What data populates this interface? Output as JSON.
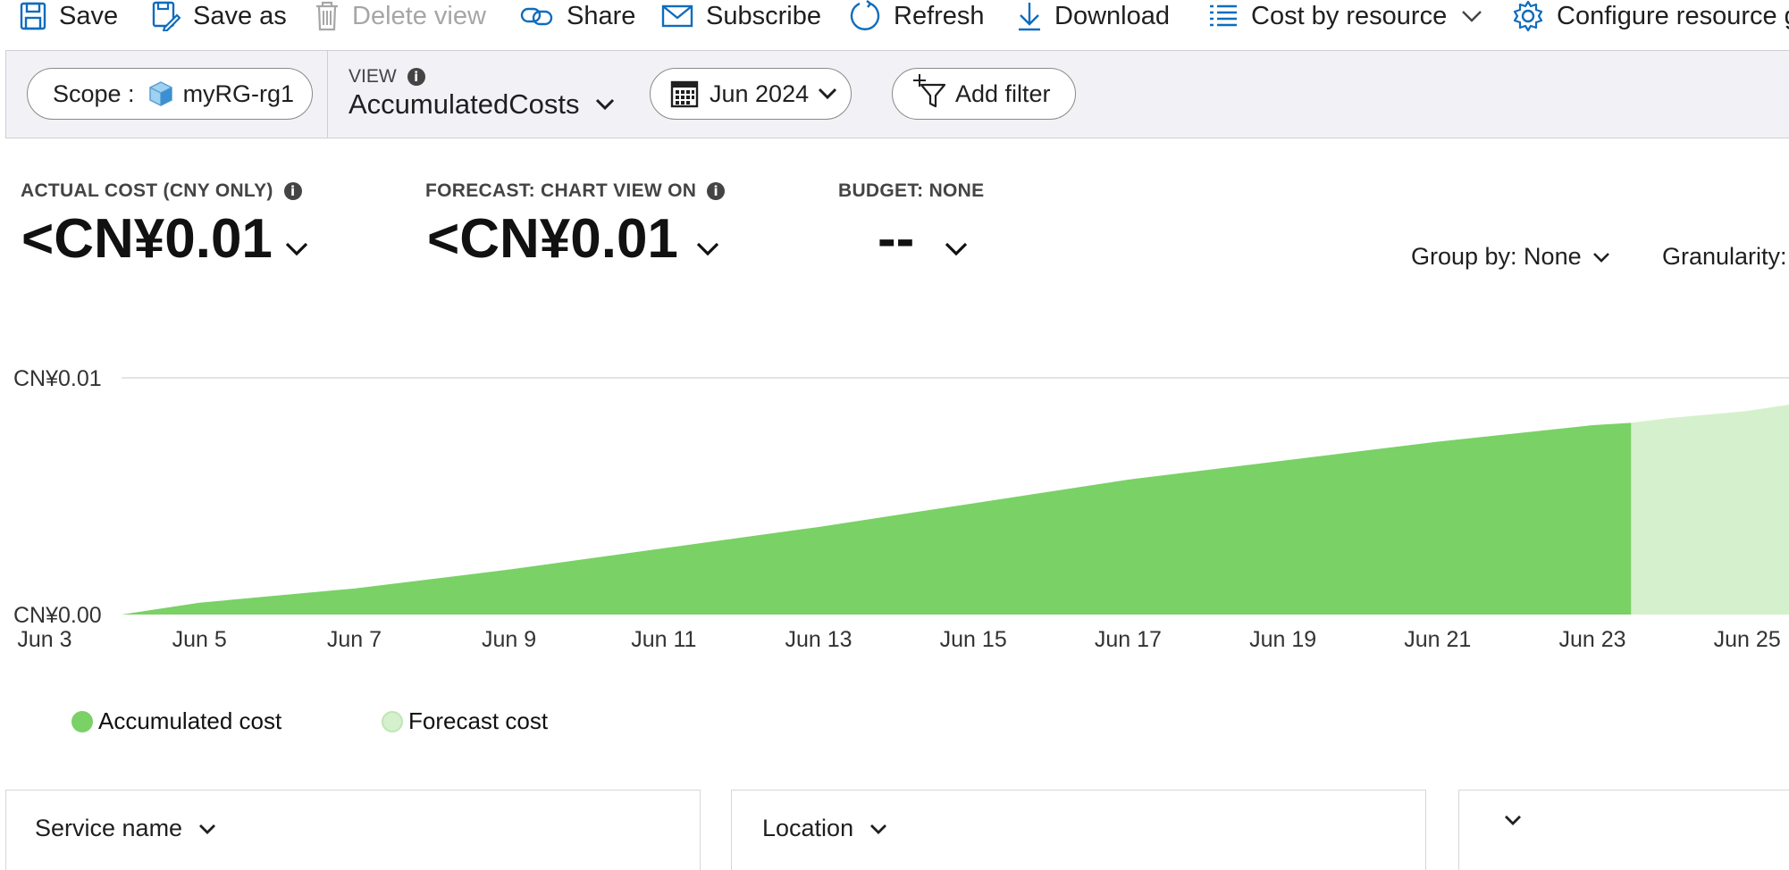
{
  "toolbar": {
    "save": "Save",
    "save_as": "Save as",
    "delete_view": "Delete view",
    "share": "Share",
    "subscribe": "Subscribe",
    "refresh": "Refresh",
    "download": "Download",
    "cost_by_resource": "Cost by resource",
    "configure": "Configure resource g"
  },
  "filters": {
    "scope_label": "Scope :",
    "scope_value": "myRG-rg1",
    "view_label": "VIEW",
    "view_value": "AccumulatedCosts",
    "date": "Jun 2024",
    "add_filter": "Add filter"
  },
  "kpis": {
    "actual_label": "ACTUAL COST (CNY ONLY)",
    "actual_value": "<CN¥0.01",
    "forecast_label": "FORECAST: CHART VIEW ON",
    "forecast_value": "<CN¥0.01",
    "budget_label": "BUDGET: NONE",
    "budget_value": "--"
  },
  "controls": {
    "group_by": "Group by: None",
    "granularity": "Granularity: "
  },
  "colors": {
    "accumulated": "#7ad166",
    "forecast": "#d5f0cd",
    "accent": "#0f6cbd"
  },
  "chart_data": {
    "type": "area",
    "ylabel": "",
    "xlabel": "",
    "ylim": [
      0,
      0.01
    ],
    "y_ticks": [
      "CN¥0.00",
      "CN¥0.01"
    ],
    "x_ticks": [
      "Jun 3",
      "Jun 5",
      "Jun 7",
      "Jun 9",
      "Jun 11",
      "Jun 13",
      "Jun 15",
      "Jun 17",
      "Jun 19",
      "Jun 21",
      "Jun 23",
      "Jun 25"
    ],
    "series": [
      {
        "name": "Accumulated cost",
        "x": [
          3,
          5,
          7,
          9,
          11,
          13,
          15,
          17,
          19,
          21,
          23,
          23.5,
          23.5
        ],
        "values": [
          0.0,
          0.0005,
          0.0011,
          0.0019,
          0.0028,
          0.0037,
          0.0047,
          0.0057,
          0.0065,
          0.0073,
          0.008,
          0.0081,
          0.0
        ]
      },
      {
        "name": "Forecast cost",
        "x": [
          23.5,
          24.0,
          25.0,
          25.6
        ],
        "values": [
          0.0081,
          0.0083,
          0.0086,
          0.0089
        ]
      }
    ],
    "legend": [
      "Accumulated cost",
      "Forecast cost"
    ],
    "grid": true
  },
  "cards": {
    "service_name": "Service name",
    "location": "Location",
    "third": ""
  }
}
